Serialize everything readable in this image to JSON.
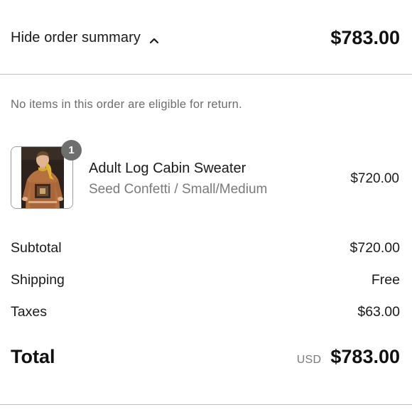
{
  "header": {
    "toggle_label": "Hide order summary",
    "total": "$783.00",
    "chevron_icon": "chevron-up-icon"
  },
  "notice": "No items in this order are eligible for return.",
  "items": [
    {
      "name": "Adult Log Cabin Sweater",
      "variant": "Seed Confetti / Small/Medium",
      "price": "$720.00",
      "quantity": "1",
      "image_icon": "product-photo"
    }
  ],
  "summary": {
    "subtotal_label": "Subtotal",
    "subtotal_value": "$720.00",
    "shipping_label": "Shipping",
    "shipping_value": "Free",
    "taxes_label": "Taxes",
    "taxes_value": "$63.00",
    "total_label": "Total",
    "currency": "USD",
    "total_value": "$783.00"
  },
  "colors": {
    "text": "#111111",
    "muted": "#7a7a7a",
    "divider": "#bdbdbd",
    "badge": "#6e6e6e"
  }
}
